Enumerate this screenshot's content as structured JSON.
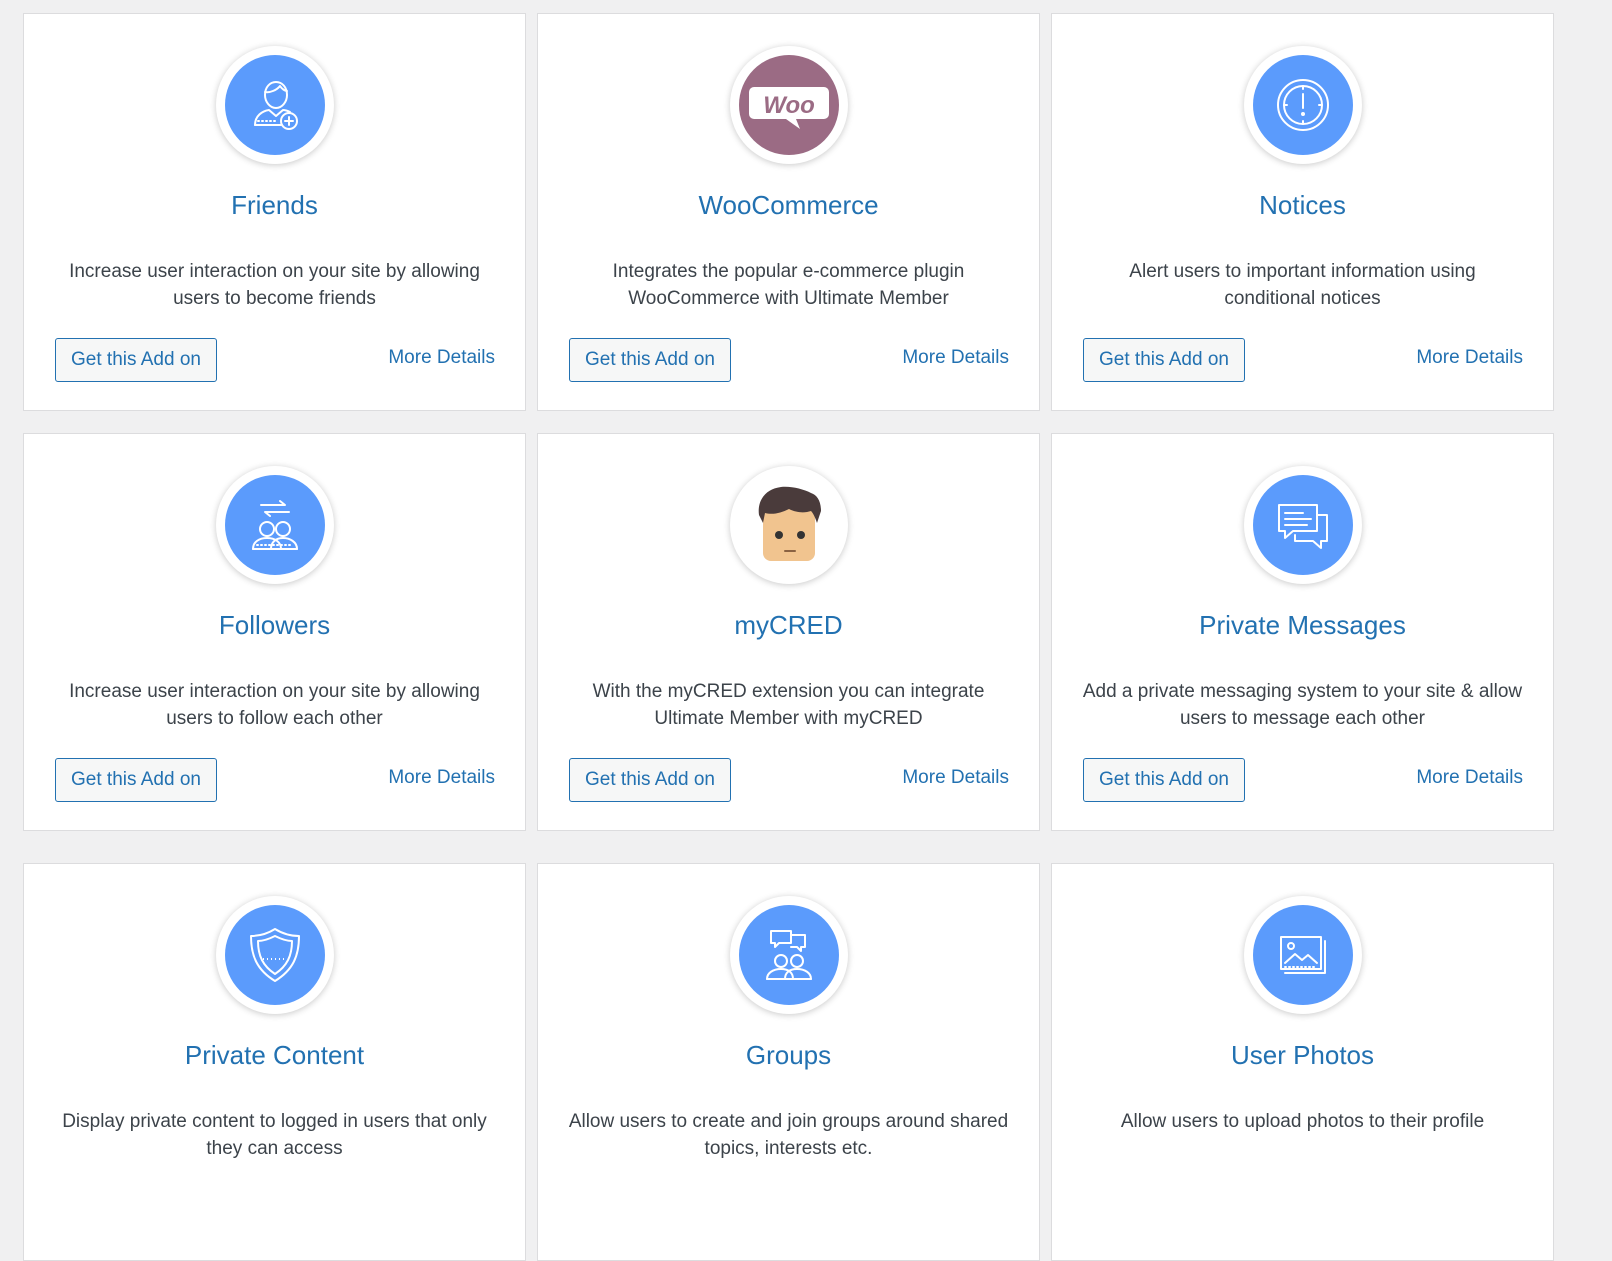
{
  "colors": {
    "page_background": "#f0f0f1",
    "card_background": "#ffffff",
    "accent_blue": "#2271b1",
    "icon_blue": "#5b9bfc",
    "woo_purple": "#9b6b84",
    "text": "#3c434a"
  },
  "addons": [
    {
      "icon": "user-plus-icon",
      "title": "Friends",
      "description": "Increase user interaction on your site by allowing users to become friends",
      "button_label": "Get this Add on",
      "link_label": "More Details"
    },
    {
      "icon": "woo-logo-icon",
      "title": "WooCommerce",
      "description": "Integrates the popular e-commerce plugin WooCommerce with Ultimate Member",
      "button_label": "Get this Add on",
      "link_label": "More Details"
    },
    {
      "icon": "alert-clock-icon",
      "title": "Notices",
      "description": "Alert users to important information using conditional notices",
      "button_label": "Get this Add on",
      "link_label": "More Details"
    },
    {
      "icon": "followers-icon",
      "title": "Followers",
      "description": "Increase user interaction on your site by allowing users to follow each other",
      "button_label": "Get this Add on",
      "link_label": "More Details"
    },
    {
      "icon": "mycred-mascot-icon",
      "title": "myCRED",
      "description": "With the myCRED extension you can integrate Ultimate Member with myCRED",
      "button_label": "Get this Add on",
      "link_label": "More Details"
    },
    {
      "icon": "chat-bubbles-icon",
      "title": "Private Messages",
      "description": "Add a private messaging system to your site & allow users to message each other",
      "button_label": "Get this Add on",
      "link_label": "More Details"
    },
    {
      "icon": "shield-icon",
      "title": "Private Content",
      "description": "Display private content to logged in users that only they can access"
    },
    {
      "icon": "group-chat-icon",
      "title": "Groups",
      "description": "Allow users to create and join groups around shared topics, interests etc."
    },
    {
      "icon": "photo-gallery-icon",
      "title": "User Photos",
      "description": "Allow users to upload photos to their profile"
    }
  ]
}
